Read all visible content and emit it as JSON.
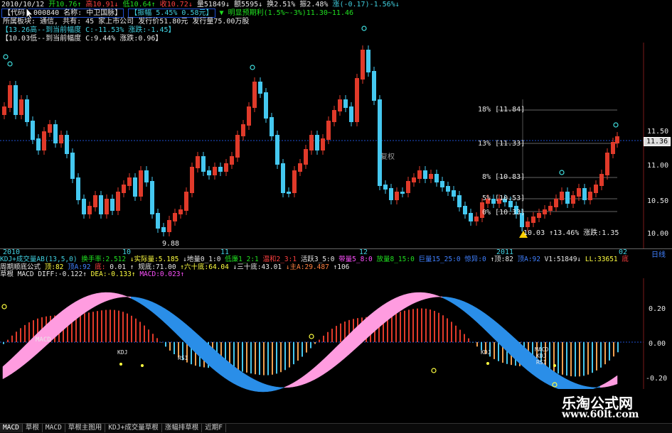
{
  "header": {
    "row1": {
      "date": "2010/10/12",
      "open": "开10.76↑",
      "high": "高10.91↓",
      "low": "低10.64↑",
      "close": "收10.72↓",
      "volume": "量51849↓",
      "amount": "额5595↓",
      "turnover": "换2.51%",
      "amplitude": "振2.48%",
      "change": "涨(-0.17)-1.56%↓"
    },
    "row2": {
      "code": "【代码: 000840 名称: 中卫国脉】",
      "amp_box": "【振幅 5.45% 0.58元】",
      "trend_box": "▼ 明显预期利(1.5%~-3%)11.30~11.46"
    },
    "row3": "所属板块: 通信, 共有: 45 家上市公司   发行价51.80元   发行量75.00万股",
    "row4": "【13.26高--到当前幅度 C:-11.53%  涨跌:-1.45】",
    "row5": "【10.03低--到当前幅度 C:9.44%  涨跌:0.96】"
  },
  "chart_labels": {
    "low_marker": "9.88",
    "fuquan": "复权",
    "last_low_label": "10.03 ↑13.46%  涨跌:1.35",
    "fib_levels": [
      "18% [11.84]",
      "13% [11.33]",
      "8% [10.83]",
      "5% [10.53]",
      "0% [10.33]"
    ],
    "price_axis": [
      "11.50",
      "11.36",
      "11.00",
      "10.50",
      "10.00"
    ],
    "current_price": "11.36",
    "period_label": "日线",
    "macd_tag": "MACD",
    "kdj_tags": [
      "KDJ",
      "RSI",
      "KDJ",
      "MACD",
      "KDJ",
      "RSI"
    ]
  },
  "time_axis": {
    "labels": [
      "2010",
      "10",
      "11",
      "12",
      "2011",
      "02"
    ]
  },
  "indicator_row1": [
    {
      "text": "KDJ+成交量AB(13,5,0)",
      "color": "#40d0e0"
    },
    {
      "text": "换手率:2.512",
      "color": "#20e020"
    },
    {
      "text": "↓实际量:5.185",
      "color": "#ffff40"
    },
    {
      "text": "↓地量0_1:0",
      "color": "#e8e8e8"
    },
    {
      "text": "低廉1_2:1",
      "color": "#20e020"
    },
    {
      "text": "温和2_3:1",
      "color": "#ff4040"
    },
    {
      "text": "活跃3_5:0",
      "color": "#e8e8e8"
    },
    {
      "text": "带量5_8:0",
      "color": "#ff50ff"
    },
    {
      "text": "放量8_15:0",
      "color": "#20e020"
    },
    {
      "text": "巨量15_25:0",
      "color": "#4080ff"
    },
    {
      "text": "惊异:0",
      "color": "#4080ff"
    },
    {
      "text": "↑顶:82",
      "color": "#e8e8e8"
    },
    {
      "text": "顶A:92",
      "color": "#4080ff"
    },
    {
      "text": "V1:51849↓",
      "color": "#e8e8e8"
    },
    {
      "text": "LL:33651",
      "color": "#ffff40"
    },
    {
      "text": "底",
      "color": "#ff4040"
    }
  ],
  "indicator_row2": [
    {
      "text": "草根 MACD DIFF:-0.122↑",
      "color": "#e8e8e8"
    },
    {
      "text": "DEA:-0.133↑",
      "color": "#ffff40"
    },
    {
      "text": "MACD:0.023↑",
      "color": "#ff50ff"
    }
  ],
  "indicator_row1b": [
    {
      "text": "周期顺底公式",
      "color": "#e8e8e8"
    },
    {
      "text": "顶:82",
      "color": "#ffff40"
    },
    {
      "text": "顶A:92",
      "color": "#4080ff"
    },
    {
      "text": "底:",
      "color": "#ff4040"
    },
    {
      "text": "0.01 ↑",
      "color": "#e8e8e8"
    },
    {
      "text": "规底:71.00",
      "color": "#e8e8e8"
    },
    {
      "text": "↑六十底:64.04",
      "color": "#ffff40"
    },
    {
      "text": "↓三十底:43.01",
      "color": "#e8e8e8"
    },
    {
      "text": "↓主A:29.487",
      "color": "#ff8040"
    },
    {
      "text": "↑106",
      "color": "#e8e8e8"
    }
  ],
  "macd_axis": [
    "0.20",
    "0.00",
    "-0.20"
  ],
  "tabs": [
    "MACD",
    "草根",
    "MACD",
    "草根主图用",
    "KDJ+成交量草根",
    "涨幅排草根",
    "近期F"
  ],
  "watermark": {
    "title": "乐淘公式网",
    "url": "www.60lt.com"
  },
  "colors": {
    "up": "#e03a2a",
    "down": "#45c8f0",
    "fill_pink": "#ff9ce0",
    "fill_blue": "#2a8ee8",
    "grid": "#7a1a1a"
  }
}
